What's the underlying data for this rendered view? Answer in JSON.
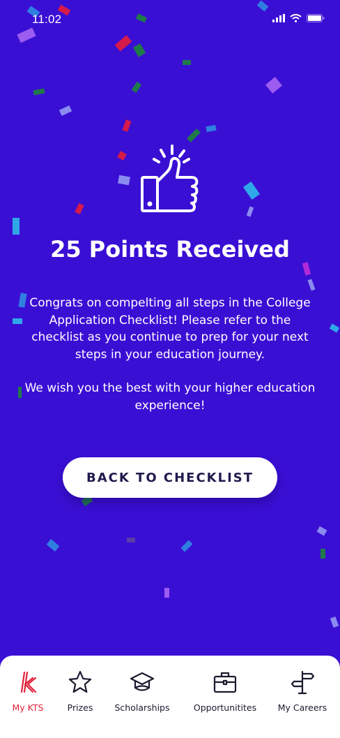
{
  "status_bar": {
    "time": "11:02"
  },
  "celebration": {
    "icon": "thumbs-up-icon",
    "headline": "25 Points Received",
    "paragraph_1": "Congrats on compelting all steps in the College Application Checklist! Please refer to the checklist as you continue to prep for your next steps in your education journey.",
    "paragraph_2": "We wish you the best with your higher education experience!",
    "cta_label": "BACK TO CHECKLIST"
  },
  "tab_bar": {
    "items": [
      {
        "label": "My KTS",
        "icon": "kts-logo-icon",
        "active": true
      },
      {
        "label": "Prizes",
        "icon": "star-icon",
        "active": false
      },
      {
        "label": "Scholarships",
        "icon": "graduation-cap-icon",
        "active": false
      },
      {
        "label": "Opportunitites",
        "icon": "briefcase-icon",
        "active": false
      },
      {
        "label": "My Careers",
        "icon": "signpost-icon",
        "active": false
      }
    ]
  },
  "colors": {
    "background": "#3a0fd4",
    "text": "#ffffff",
    "cta_text": "#1e1a4d",
    "tab_active": "#e0213a",
    "tab_inactive": "#1a1a2e"
  }
}
